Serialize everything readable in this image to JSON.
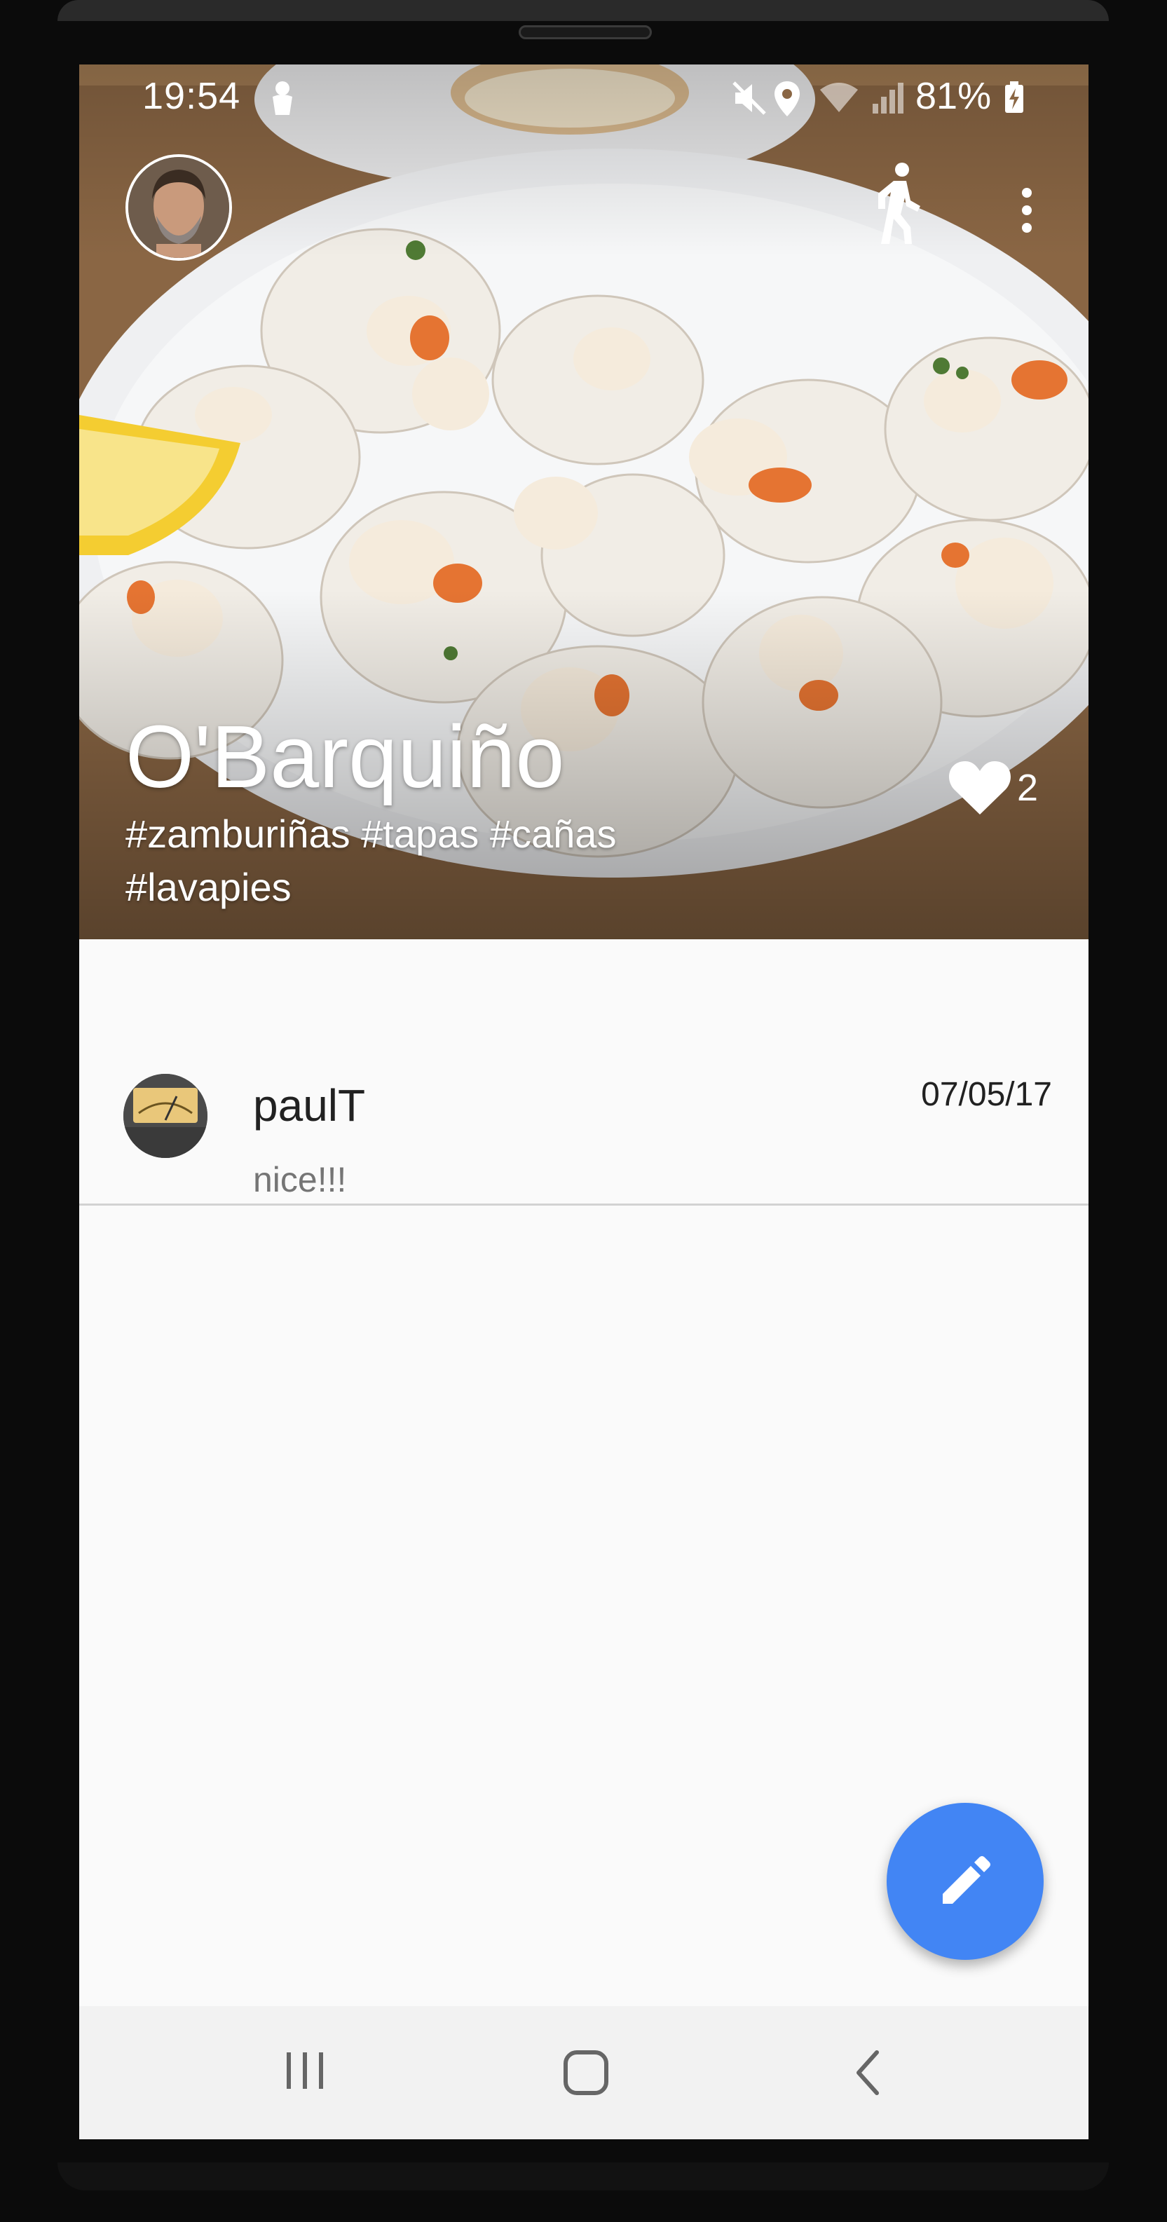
{
  "status_bar": {
    "time": "19:54",
    "battery": "81%",
    "icons": [
      "ninja-notification-icon",
      "mute-icon",
      "location-icon",
      "wifi-icon",
      "signal-icon",
      "battery-charging-icon"
    ]
  },
  "app_bar": {
    "avatar_icon": "user-avatar",
    "walk_icon": "directions-walk-icon",
    "more_icon": "more-vert-icon"
  },
  "place": {
    "title": "O'Barquiño",
    "tags": "#zamburiñas #tapas #cañas #lavapies",
    "likes": "2"
  },
  "comments": [
    {
      "user": "paulT",
      "date": "07/05/17",
      "text": "nice!!!"
    }
  ],
  "fab": {
    "icon": "edit-pencil-icon"
  },
  "nav_bar": {
    "items": [
      "recent-apps-icon",
      "home-icon",
      "back-icon"
    ]
  },
  "colors": {
    "accent": "#4285f4",
    "background": "#fafafa",
    "nav_background": "#f2f2f2",
    "divider": "#d2d2d2",
    "secondary_text": "#757575"
  }
}
